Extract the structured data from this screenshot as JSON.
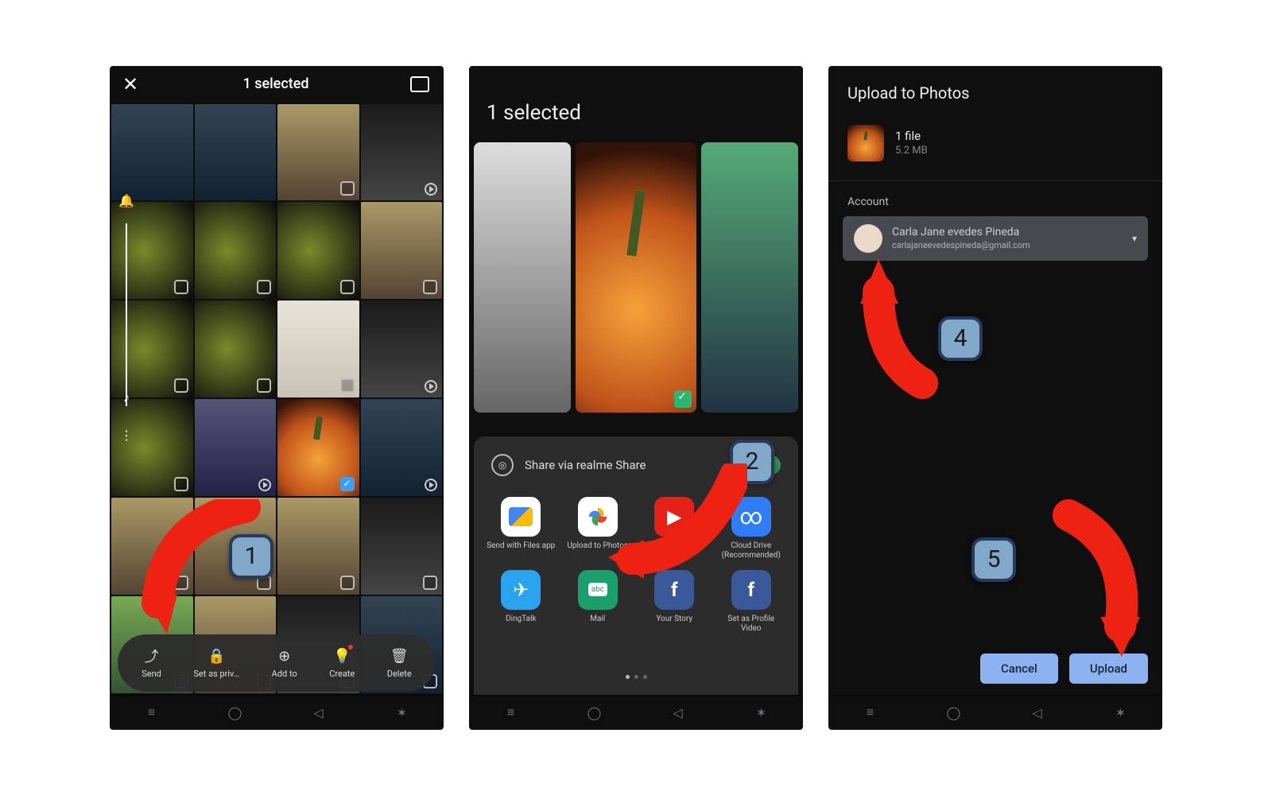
{
  "steps": [
    "1",
    "2",
    "4",
    "5"
  ],
  "screen1": {
    "title": "1 selected",
    "actions": {
      "send": "Send",
      "private": "Set as priv…",
      "addto": "Add to",
      "create": "Create",
      "delete": "Delete"
    }
  },
  "screen2": {
    "title": "1 selected",
    "realme": "Share via realme Share",
    "apps": {
      "files": "Send with Files app",
      "photos": "Upload to Photos",
      "youtube": "YouTube",
      "cloud": "Cloud Drive (Recommended)",
      "ding": "DingTalk",
      "mail": "Mail",
      "story": "Your Story",
      "profile": "Set as Profile Video"
    }
  },
  "screen3": {
    "title": "Upload to Photos",
    "file_count": "1 file",
    "file_size": "5.2 MB",
    "account_label": "Account",
    "account_name": "Carla Jane evedes Pineda",
    "account_email": "carlajaneevedespineda@gmail.com",
    "cancel": "Cancel",
    "upload": "Upload"
  }
}
